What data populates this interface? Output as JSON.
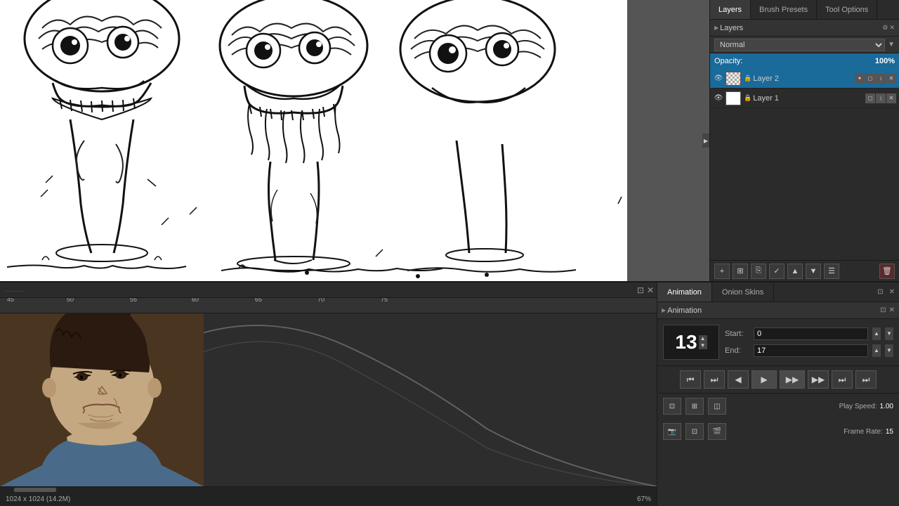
{
  "tabs": {
    "layers_label": "Layers",
    "brush_presets_label": "Brush Presets",
    "tool_options_label": "Tool Options"
  },
  "layers_panel": {
    "header_label": "Layers",
    "blend_mode": "Normal",
    "opacity_label": "Opacity:",
    "opacity_value": "100%",
    "layers": [
      {
        "name": "Layer 2",
        "active": true,
        "thumb_type": "checker"
      },
      {
        "name": "Layer 1",
        "active": false,
        "thumb_type": "white"
      }
    ]
  },
  "animation_tabs": {
    "animation_label": "Animation",
    "onion_skins_label": "Onion Skins"
  },
  "animation_panel": {
    "header_label": "Animation",
    "current_frame": "13",
    "start_label": "Start:",
    "start_value": "0",
    "end_label": "End:",
    "end_value": "17",
    "play_speed_label": "Play Speed:",
    "play_speed_value": "1.00",
    "frame_rate_label": "Frame Rate:",
    "frame_rate_value": "15"
  },
  "timeline": {
    "ruler_marks": [
      "45",
      "50",
      "55",
      "60",
      "65",
      "70",
      "75"
    ],
    "dots": "......."
  },
  "status_bar": {
    "dimensions": "1024 x 1024 (14.2M)",
    "zoom": "67%"
  },
  "playback_buttons": {
    "first": "⏮",
    "prev_key": "⏭",
    "prev": "◀",
    "play": "▶",
    "next": "▶▶",
    "next_key": "⏭",
    "last": "⏭"
  }
}
